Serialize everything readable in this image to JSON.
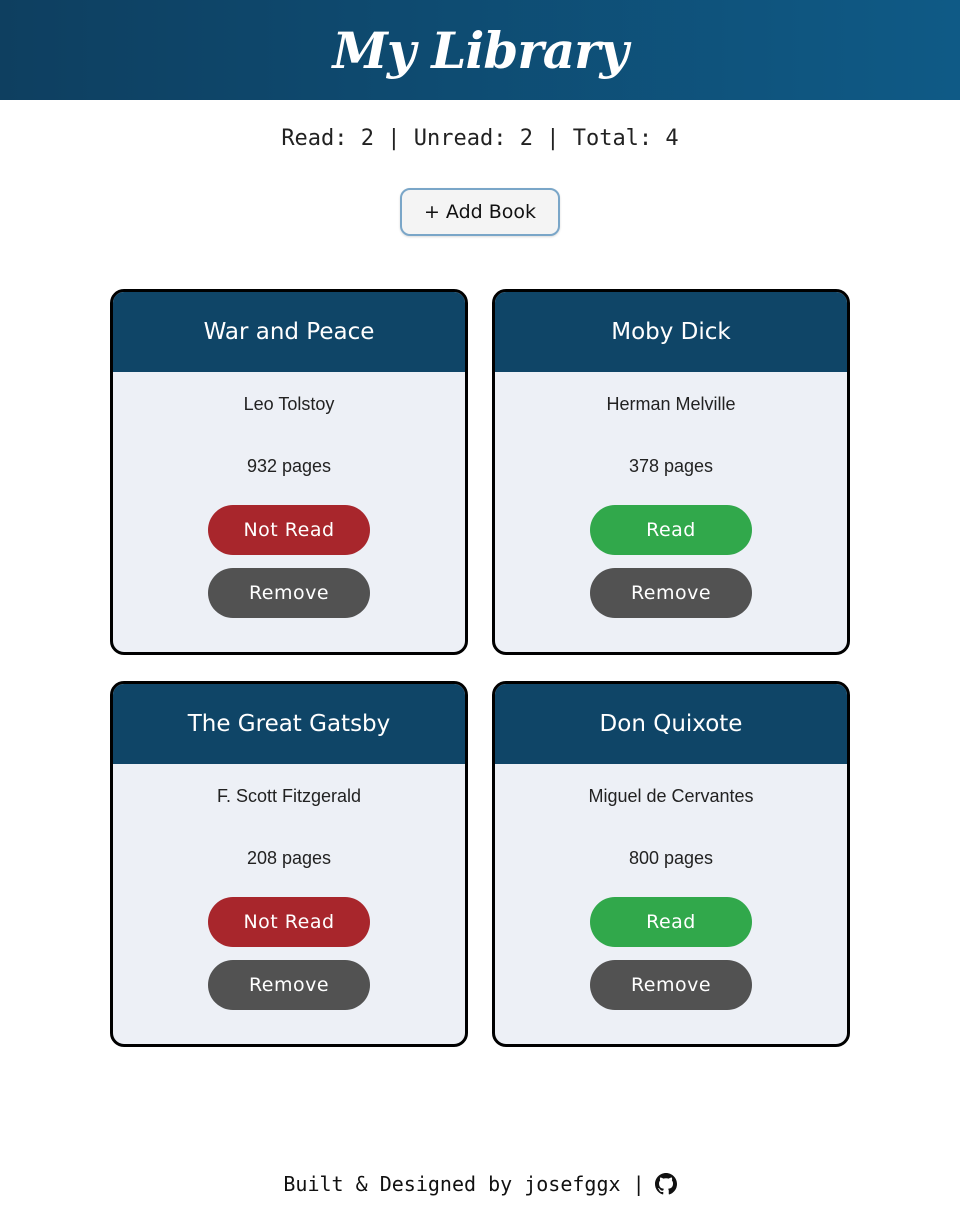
{
  "header": {
    "title": "My Library"
  },
  "stats": {
    "text": "Read: 2 | Unread: 2 | Total: 4"
  },
  "actions": {
    "add_label": "+ Add Book"
  },
  "colors": {
    "read": "#31a84b",
    "not_read": "#a8262c",
    "remove": "#525252",
    "card_header": "#0f4567"
  },
  "books": [
    {
      "title": "War and Peace",
      "author": "Leo Tolstoy",
      "pages": "932 pages",
      "status": "Not Read",
      "status_color": "#a8262c",
      "remove": "Remove"
    },
    {
      "title": "Moby Dick",
      "author": "Herman Melville",
      "pages": "378 pages",
      "status": "Read",
      "status_color": "#31a84b",
      "remove": "Remove"
    },
    {
      "title": "The Great Gatsby",
      "author": "F. Scott Fitzgerald",
      "pages": "208 pages",
      "status": "Not Read",
      "status_color": "#a8262c",
      "remove": "Remove"
    },
    {
      "title": "Don Quixote",
      "author": "Miguel de Cervantes",
      "pages": "800 pages",
      "status": "Read",
      "status_color": "#31a84b",
      "remove": "Remove"
    }
  ],
  "footer": {
    "text": "Built & Designed by josefggx |",
    "icon": "github-icon"
  }
}
